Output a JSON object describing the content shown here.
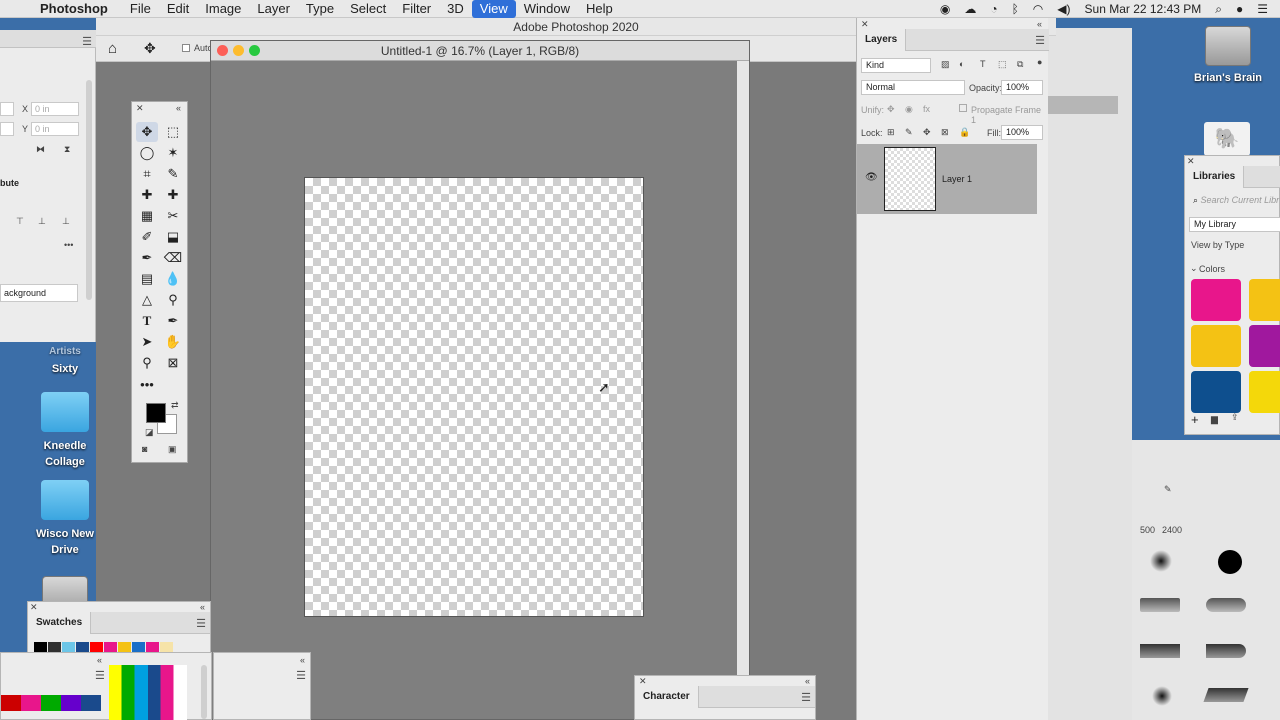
{
  "menubar": {
    "app": "Photoshop",
    "items": [
      "File",
      "Edit",
      "Image",
      "Layer",
      "Type",
      "Select",
      "Filter",
      "3D",
      "View",
      "Window",
      "Help"
    ],
    "clock": "Sun Mar 22  12:43 PM"
  },
  "app_title": "Adobe Photoshop 2020",
  "document": {
    "title": "Untitled-1 @ 16.7% (Layer 1, RGB/8)"
  },
  "options_bar": {
    "auto_label": "Auto"
  },
  "properties": {
    "x_label": "X",
    "x_value": "0 in",
    "y_label": "Y",
    "y_value": "0 in",
    "section": "bute",
    "layer_field": "ackground"
  },
  "desktop": {
    "icons": [
      {
        "label": "Sixty",
        "sub": "Artists"
      },
      {
        "label": "Kneedle Collage"
      },
      {
        "label": "Wisco New Drive"
      },
      {
        "label": "Brian's Brain"
      }
    ]
  },
  "layers_panel": {
    "tab": "Layers",
    "filter": "Kind",
    "blend_mode": "Normal",
    "opacity_label": "Opacity:",
    "opacity_value": "100%",
    "unify_label": "Unify:",
    "propagate_label": "Propagate Frame 1",
    "lock_label": "Lock:",
    "fill_label": "Fill:",
    "fill_value": "100%",
    "layers": [
      {
        "name": "Layer 1"
      }
    ]
  },
  "libraries": {
    "tab": "Libraries",
    "search_placeholder": "Search Current Libr",
    "library": "My Library",
    "view_by": "View by Type",
    "colors_label": "Colors",
    "colors": [
      "#e8168b",
      "#f4c214",
      "#f4c214",
      "#a0189e",
      "#0e4f8e",
      "#f4d80a"
    ]
  },
  "brushes": {
    "sizes": [
      "500",
      "2400"
    ]
  },
  "swatches_panel": {
    "tab": "Swatches",
    "row": [
      "#000000",
      "#303030",
      "#6cc6e8",
      "#1a4a8c",
      "#ff0000",
      "#e8168b",
      "#f4c214",
      "#1a6fc8",
      "#e8168b",
      "#f6e3a8"
    ]
  },
  "character_panel": {
    "tab": "Character"
  }
}
